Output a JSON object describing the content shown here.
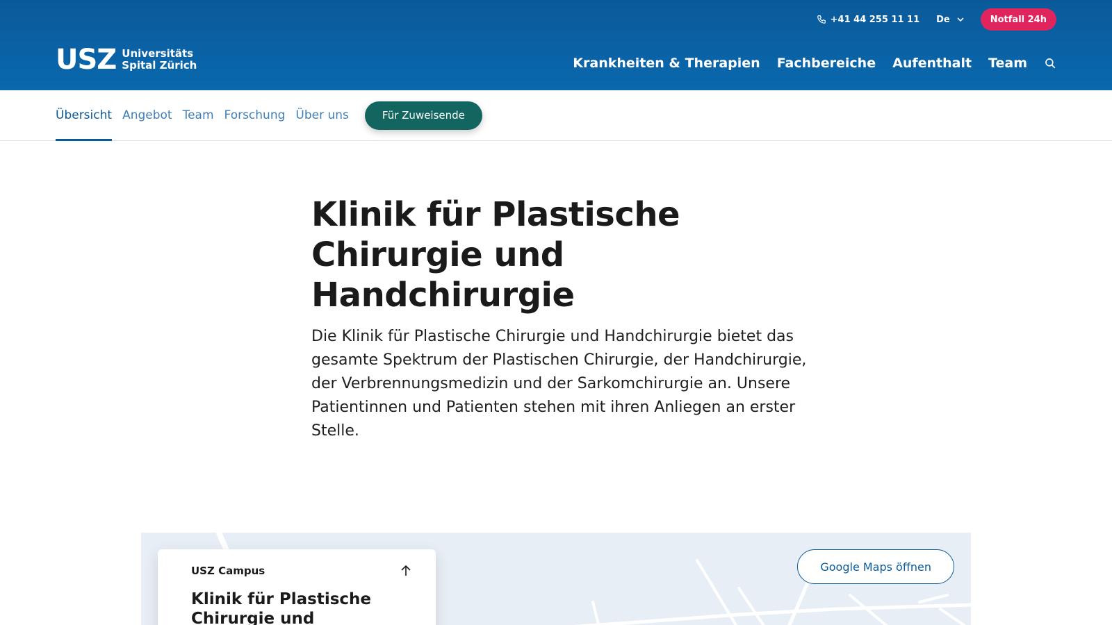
{
  "header": {
    "phone": "+41 44 255 11 11",
    "language": "De",
    "emergency_label": "Notfall 24h",
    "logo_mark": "USZ",
    "logo_line1": "Universitäts",
    "logo_line2": "Spital Zürich",
    "nav": [
      "Krankheiten & Therapien",
      "Fachbereiche",
      "Aufenthalt",
      "Team"
    ]
  },
  "subnav": {
    "items": [
      "Übersicht",
      "Angebot",
      "Team",
      "Forschung",
      "Über uns"
    ],
    "active": "Übersicht",
    "referrer_label": "Für Zuweisende"
  },
  "hero": {
    "title": "Klinik für Plastische Chirurgie und Handchirurgie",
    "lead": "Die Klinik für Plastische Chirurgie und Handchirurgie bietet das gesamte Spektrum der Plastischen Chirurgie, der Handchirurgie, der Verbrennungsmedizin und der Sarkomchirurgie an. Unsere Patientinnen und Patienten stehen mit ihren Anliegen an erster Stelle."
  },
  "map": {
    "card_eyebrow": "USZ Campus",
    "card_title": "Klinik für Plastische Chirurgie und Handchirurgie",
    "maps_button": "Google Maps öffnen"
  },
  "colors": {
    "header_blue": "#0a5a9a",
    "emergency": "#e0245e",
    "referrer_green": "#12665f",
    "link_blue": "#3f7fb6"
  },
  "icons": [
    "phone-icon",
    "chevron-down-icon",
    "search-icon",
    "arrow-up-icon"
  ]
}
